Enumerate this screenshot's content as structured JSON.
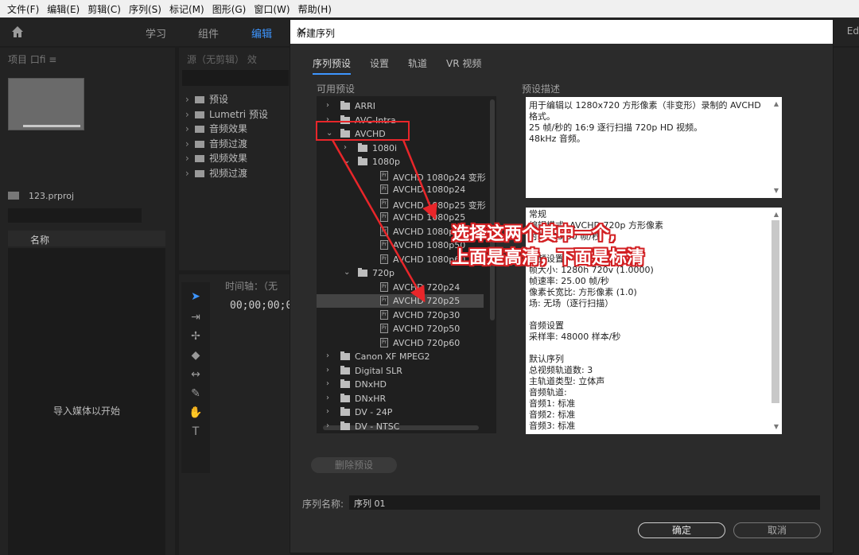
{
  "menubar": {
    "items": [
      "文件(F)",
      "编辑(E)",
      "剪辑(C)",
      "序列(S)",
      "标记(M)",
      "图形(G)",
      "窗口(W)",
      "帮助(H)"
    ]
  },
  "workspace": {
    "tabs": [
      "学习",
      "组件",
      "编辑"
    ],
    "active_tab": "编辑",
    "right_label": "Ed"
  },
  "project_panel": {
    "header": "项目 口fi ≡",
    "file_name": "123.prproj",
    "column_name": "名称",
    "empty_text": "导入媒体以开始"
  },
  "effects_panel": {
    "header": "源（无剪辑）  效",
    "items": [
      "预设",
      "Lumetri 预设",
      "音频效果",
      "音频过渡",
      "视频效果",
      "视频过渡"
    ]
  },
  "timeline_panel": {
    "header": "时间轴：（无",
    "timecode": "00;00;00;00"
  },
  "dialog": {
    "title": "新建序列",
    "tabs": [
      "序列预设",
      "设置",
      "轨道",
      "VR 视频"
    ],
    "active_tab": "序列预设",
    "available_presets_label": "可用预设",
    "preset_desc_label": "预设描述",
    "tree": [
      {
        "level": 0,
        "type": "folder",
        "expanded": false,
        "label": "ARRI"
      },
      {
        "level": 0,
        "type": "folder",
        "expanded": false,
        "label": "AVC-Intra"
      },
      {
        "level": 0,
        "type": "folder",
        "expanded": true,
        "label": "AVCHD"
      },
      {
        "level": 1,
        "type": "folder",
        "expanded": false,
        "label": "1080i"
      },
      {
        "level": 1,
        "type": "folder",
        "expanded": true,
        "label": "1080p"
      },
      {
        "level": 2,
        "type": "preset",
        "label": "AVCHD 1080p24 变形"
      },
      {
        "level": 2,
        "type": "preset",
        "label": "AVCHD 1080p24"
      },
      {
        "level": 2,
        "type": "preset",
        "label": "AVCHD 1080p25 变形"
      },
      {
        "level": 2,
        "type": "preset",
        "label": "AVCHD 1080p25"
      },
      {
        "level": 2,
        "type": "preset",
        "label": "AVCHD 1080p30"
      },
      {
        "level": 2,
        "type": "preset",
        "label": "AVCHD 1080p50"
      },
      {
        "level": 2,
        "type": "preset",
        "label": "AVCHD 1080p60"
      },
      {
        "level": 1,
        "type": "folder",
        "expanded": true,
        "label": "720p"
      },
      {
        "level": 2,
        "type": "preset",
        "label": "AVCHD 720p24"
      },
      {
        "level": 2,
        "type": "preset",
        "label": "AVCHD 720p25",
        "selected": true
      },
      {
        "level": 2,
        "type": "preset",
        "label": "AVCHD 720p30"
      },
      {
        "level": 2,
        "type": "preset",
        "label": "AVCHD 720p50"
      },
      {
        "level": 2,
        "type": "preset",
        "label": "AVCHD 720p60"
      },
      {
        "level": 0,
        "type": "folder",
        "expanded": false,
        "label": "Canon XF MPEG2"
      },
      {
        "level": 0,
        "type": "folder",
        "expanded": false,
        "label": "Digital SLR"
      },
      {
        "level": 0,
        "type": "folder",
        "expanded": false,
        "label": "DNxHD"
      },
      {
        "level": 0,
        "type": "folder",
        "expanded": false,
        "label": "DNxHR"
      },
      {
        "level": 0,
        "type": "folder",
        "expanded": false,
        "label": "DV - 24P"
      },
      {
        "level": 0,
        "type": "folder",
        "expanded": false,
        "label": "DV - NTSC"
      }
    ],
    "description_lines": [
      "用于编辑以 1280x720 方形像素（非变形）录制的 AVCHD",
      "格式。",
      "25 帧/秒的 16:9 逐行扫描 720p HD 视频。",
      "48kHz 音频。"
    ],
    "info_lines": [
      "常规",
      " 编辑模式: AVCHD 720p 方形像素",
      " 时基: 25.00 帧/秒",
      "",
      " 视频设置",
      " 帧大小: 1280h 720v (1.0000)",
      " 帧速率: 25.00  帧/秒",
      " 像素长宽比: 方形像素 (1.0)",
      " 场: 无场（逐行扫描）",
      "",
      "音频设置",
      " 采样率: 48000 样本/秒",
      "",
      "默认序列",
      " 总视频轨道数: 3",
      " 主轨道类型: 立体声",
      " 音频轨道:",
      " 音频1: 标准",
      " 音频2: 标准",
      " 音频3: 标准"
    ],
    "delete_preset_label": "删除预设",
    "sequence_name_label": "序列名称:",
    "sequence_name_value": "序列 01",
    "ok_label": "确定",
    "cancel_label": "取消"
  },
  "annotation": {
    "line1": "选择这两个其中一个,",
    "line2": "上面是高清，下面是标清",
    "color": "#e8262a"
  }
}
